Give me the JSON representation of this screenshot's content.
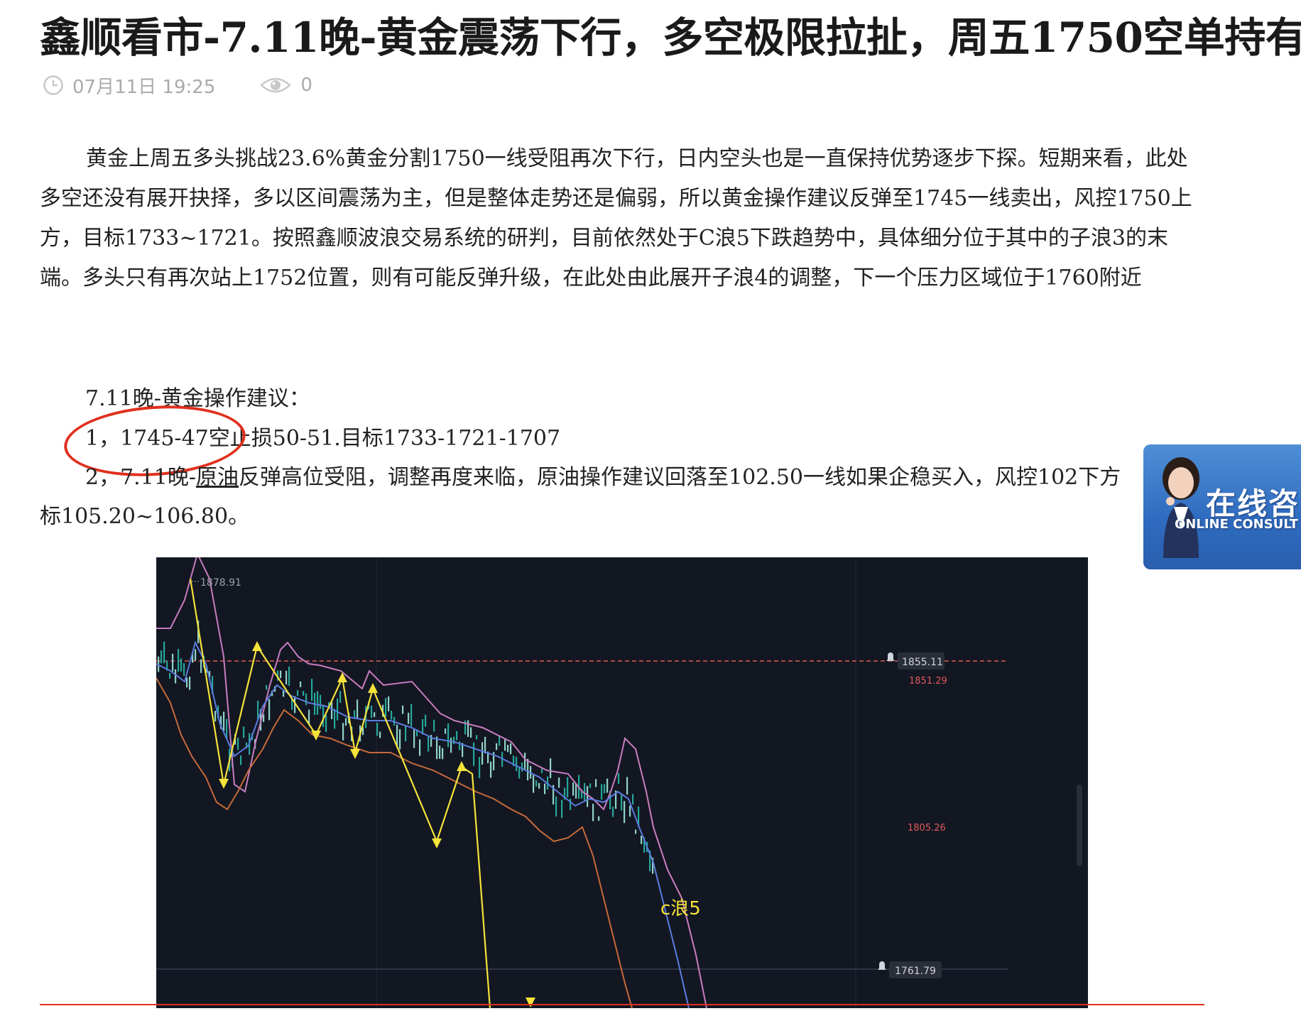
{
  "article": {
    "title": "鑫顺看市-7.11晚-黄金震荡下行，多空极限拉扯，周五1750空单持有",
    "date": "07月11日 19:25",
    "views": "0",
    "paragraph1": "黄金上周五多头挑战23.6%黄金分割1750一线受阻再次下行，日内空头也是一直保持优势逐步下探。短期来看，此处多空还没有展开抉择，多以区间震荡为主，但是整体走势还是偏弱，所以黄金操作建议反弹至1745一线卖出，风控1750上方，目标1733~1721。按照鑫顺波浪交易系统的研判，目前依然处于C浪5下跌趋势中，具体细分位于其中的子浪3的末端。多头只有再次站上1752位置，则有可能反弹升级，在此处由此展开子浪4的调整，下一个压力区域位于1760附近",
    "advice_heading": "7.11晚-黄金操作建议：",
    "advice_1": "1，1745-47空止损50-51.目标1733-1721-1707",
    "advice_2_prefix": "2，7.11晚-",
    "advice_2_link": "原油",
    "advice_2_rest": "反弹高位受阻，调整再度来临，原油操作建议回落至102.50一线如果企稳买入，风控102下方",
    "advice_2_cont": "标105.20~106.80。"
  },
  "consult_widget": {
    "label_cn": "在线咨",
    "label_en": "ONLINE CONSULT"
  },
  "chart_data": {
    "type": "line",
    "wave_label": "c浪5",
    "price_labels": {
      "high_marker": "1878.91",
      "alert_upper": "1855.11",
      "current_red": "1851.29",
      "mid_red": "1805.26",
      "alert_lower": "1761.79"
    },
    "colors": {
      "background": "#131722",
      "wave_lines": "#ffeb3b",
      "upper_band": "#c77dbe",
      "mid_line": "#5b7ce0",
      "lower_band": "#c46a3a",
      "candles_up": "#26a69a",
      "alert_line": "#e05a5a"
    }
  }
}
